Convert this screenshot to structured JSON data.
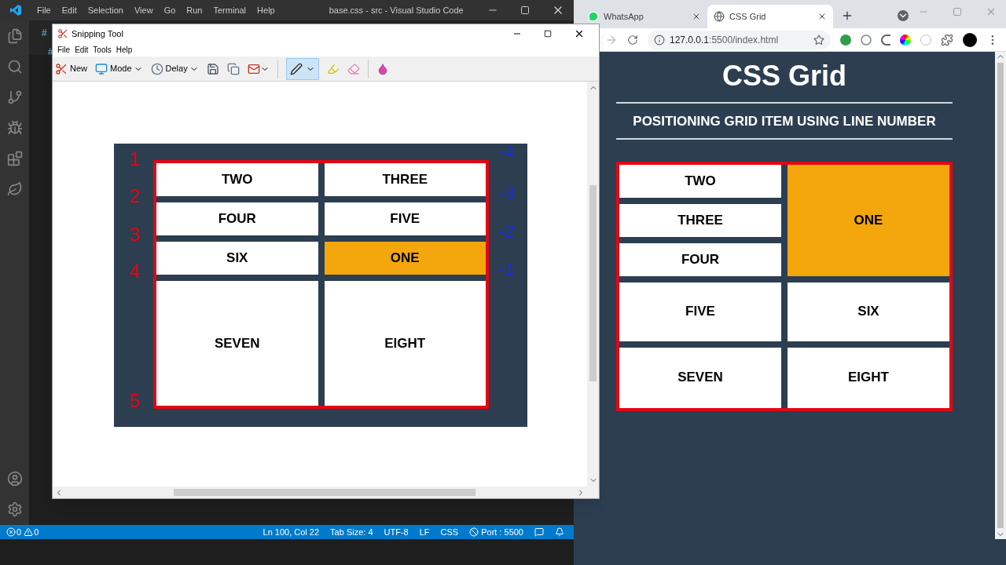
{
  "vscode": {
    "menu": [
      "File",
      "Edit",
      "Selection",
      "View",
      "Go",
      "Run",
      "Terminal",
      "Help"
    ],
    "title": "base.css - src - Visual Studio Code",
    "editor_marks": [
      "#",
      "#"
    ],
    "status_bar": {
      "errors": "0",
      "warnings": "0",
      "items": [
        "Ln 100, Col 22",
        "Tab Size: 4",
        "UTF-8",
        "LF",
        "CSS"
      ],
      "port": "Port : 5500"
    }
  },
  "snipping_tool": {
    "title": "Snipping Tool",
    "menu": [
      "File",
      "Edit",
      "Tools",
      "Help"
    ],
    "toolbar": [
      {
        "kind": "new",
        "label": "New"
      },
      {
        "kind": "mode",
        "label": "Mode"
      },
      {
        "kind": "delay",
        "label": "Delay"
      }
    ],
    "pen_selected": true,
    "capture": {
      "rows": [
        [
          {
            "label": "TWO",
            "highlighted": false
          },
          {
            "label": "THREE",
            "highlighted": false
          }
        ],
        [
          {
            "label": "FOUR",
            "highlighted": false
          },
          {
            "label": "FIVE",
            "highlighted": false
          }
        ],
        [
          {
            "label": "SIX",
            "highlighted": false
          },
          {
            "label": "ONE",
            "highlighted": true
          }
        ],
        [
          {
            "label": "SEVEN",
            "highlighted": false
          },
          {
            "label": "EIGHT",
            "highlighted": false
          }
        ]
      ],
      "left_marks": [
        "1",
        "2",
        "3",
        "4",
        "5"
      ],
      "right_marks": [
        "-4",
        "-3",
        "-2",
        "-1"
      ]
    }
  },
  "browser": {
    "tabs": [
      {
        "title": "WhatsApp",
        "selected": false
      },
      {
        "title": "CSS Grid",
        "selected": true
      }
    ],
    "url_host": "127.0.0.1",
    "url_rest": ":5500/index.html",
    "page": {
      "heading": "CSS Grid",
      "subheading": "POSITIONING GRID ITEM USING LINE NUMBER",
      "stacked": [
        {
          "label": "TWO",
          "highlighted": false
        },
        {
          "label": "THREE",
          "highlighted": false
        },
        {
          "label": "FOUR",
          "highlighted": false
        }
      ],
      "spanning": {
        "label": "ONE",
        "highlighted": true
      },
      "rows": [
        [
          {
            "label": "FIVE",
            "highlighted": false
          },
          {
            "label": "SIX",
            "highlighted": false
          }
        ],
        [
          {
            "label": "SEVEN",
            "highlighted": false
          },
          {
            "label": "EIGHT",
            "highlighted": false
          }
        ]
      ]
    }
  }
}
